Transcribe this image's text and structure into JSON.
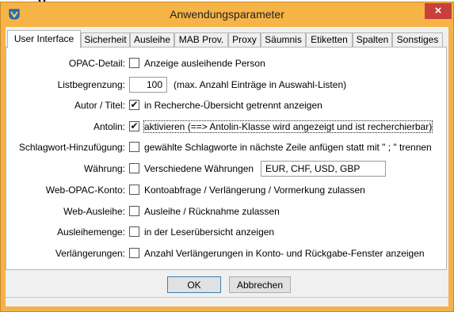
{
  "window": {
    "title": "Anwendungsparameter",
    "close_glyph": "×",
    "top_cut_text": "g"
  },
  "tabs": [
    {
      "label": "User Interface",
      "active": true
    },
    {
      "label": "Sicherheit"
    },
    {
      "label": "Ausleihe"
    },
    {
      "label": "MAB Prov."
    },
    {
      "label": "Proxy"
    },
    {
      "label": "Säumnis"
    },
    {
      "label": "Etiketten"
    },
    {
      "label": "Spalten"
    },
    {
      "label": "Sonstiges"
    }
  ],
  "settings": {
    "opac_detail": {
      "label": "OPAC-Detail:",
      "checked": false,
      "text": "Anzeige ausleihende Person"
    },
    "listbegrenzung": {
      "label": "Listbegrenzung:",
      "value": "100",
      "text": "(max. Anzahl Einträge in Auswahl-Listen)"
    },
    "autor_titel": {
      "label": "Autor / Titel:",
      "checked": true,
      "text": "in Recherche-Übersicht getrennt anzeigen"
    },
    "antolin": {
      "label": "Antolin:",
      "checked": true,
      "text": "aktivieren (==> Antolin-Klasse wird angezeigt und ist recherchierbar)"
    },
    "schlagwort": {
      "label": "Schlagwort-Hinzufügung:",
      "checked": false,
      "text": "gewählte Schlagworte in nächste Zeile anfügen statt mit \" ; \" trennen"
    },
    "waehrung": {
      "label": "Währung:",
      "checked": false,
      "text": "Verschiedene Währungen",
      "value": "EUR, CHF, USD, GBP"
    },
    "web_opac_konto": {
      "label": "Web-OPAC-Konto:",
      "checked": false,
      "text": "Kontoabfrage / Verlängerung / Vormerkung zulassen"
    },
    "web_ausleihe": {
      "label": "Web-Ausleihe:",
      "checked": false,
      "text": "Ausleihe / Rücknahme zulassen"
    },
    "ausleihemenge": {
      "label": "Ausleihemenge:",
      "checked": false,
      "text": "in der Leserübersicht anzeigen"
    },
    "verlaengerungen": {
      "label": "Verlängerungen:",
      "checked": false,
      "text": "Anzahl Verlängerungen in Konto- und Rückgabe-Fenster anzeigen"
    }
  },
  "buttons": {
    "ok": "OK",
    "cancel": "Abbrechen"
  },
  "colors": {
    "titlebar": "#f6b447",
    "close": "#c7413a",
    "panel": "#ffffff",
    "client": "#f0f0f0"
  },
  "icons": {
    "app": "app-logo-icon",
    "close": "close-icon",
    "check": "✔"
  }
}
